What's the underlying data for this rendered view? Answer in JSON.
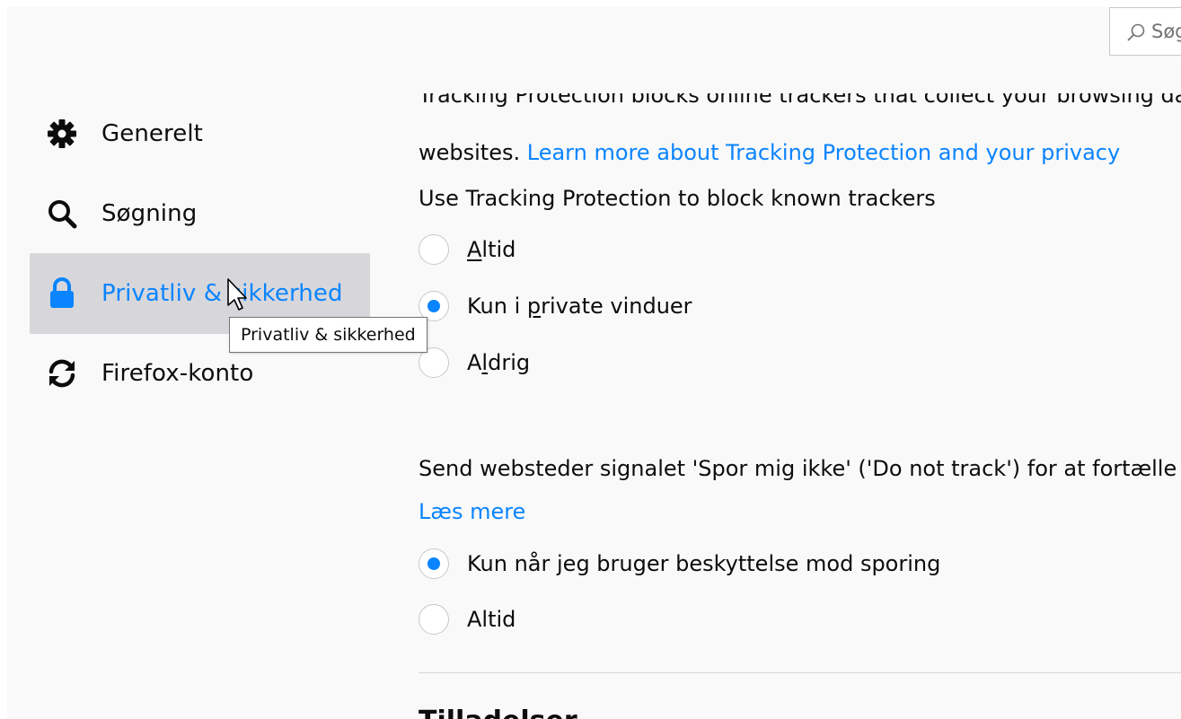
{
  "search": {
    "placeholder": "Søg"
  },
  "sidebar": {
    "items": [
      {
        "label": "Generelt",
        "icon": "gear-icon"
      },
      {
        "label": "Søgning",
        "icon": "search-icon"
      },
      {
        "label": "Privatliv & sikkerhed",
        "icon": "lock-icon",
        "selected": true
      },
      {
        "label": "Firefox-konto",
        "icon": "sync-icon"
      }
    ]
  },
  "tooltip": {
    "text": "Privatliv & sikkerhed"
  },
  "tracking": {
    "description_line1": "Tracking Protection blocks online trackers that collect your browsing data across multiple",
    "description_line2_prefix": "websites. ",
    "learn_more_link": "Learn more about Tracking Protection and your privacy",
    "use_label": "Use Tracking Protection to block known trackers",
    "options": [
      {
        "pre": "",
        "u": "A",
        "post": "ltid",
        "checked": false
      },
      {
        "pre": "Kun i ",
        "u": "p",
        "post": "rivate vinduer",
        "checked": true
      },
      {
        "pre": "A",
        "u": "l",
        "post": "drig",
        "checked": false
      }
    ]
  },
  "dnt": {
    "description": "Send websteder signalet 'Spor mig ikke' ('Do not track') for at fortælle",
    "read_more_link": "Læs mere",
    "options": [
      {
        "label": "Kun når jeg bruger beskyttelse mod sporing",
        "checked": true
      },
      {
        "label": "Altid",
        "checked": false
      }
    ]
  },
  "next_section": {
    "heading": "Tilladelser"
  },
  "colors": {
    "accent": "#0a84ff",
    "text": "#0c0c0d",
    "selected_bg": "#d7d7db"
  }
}
